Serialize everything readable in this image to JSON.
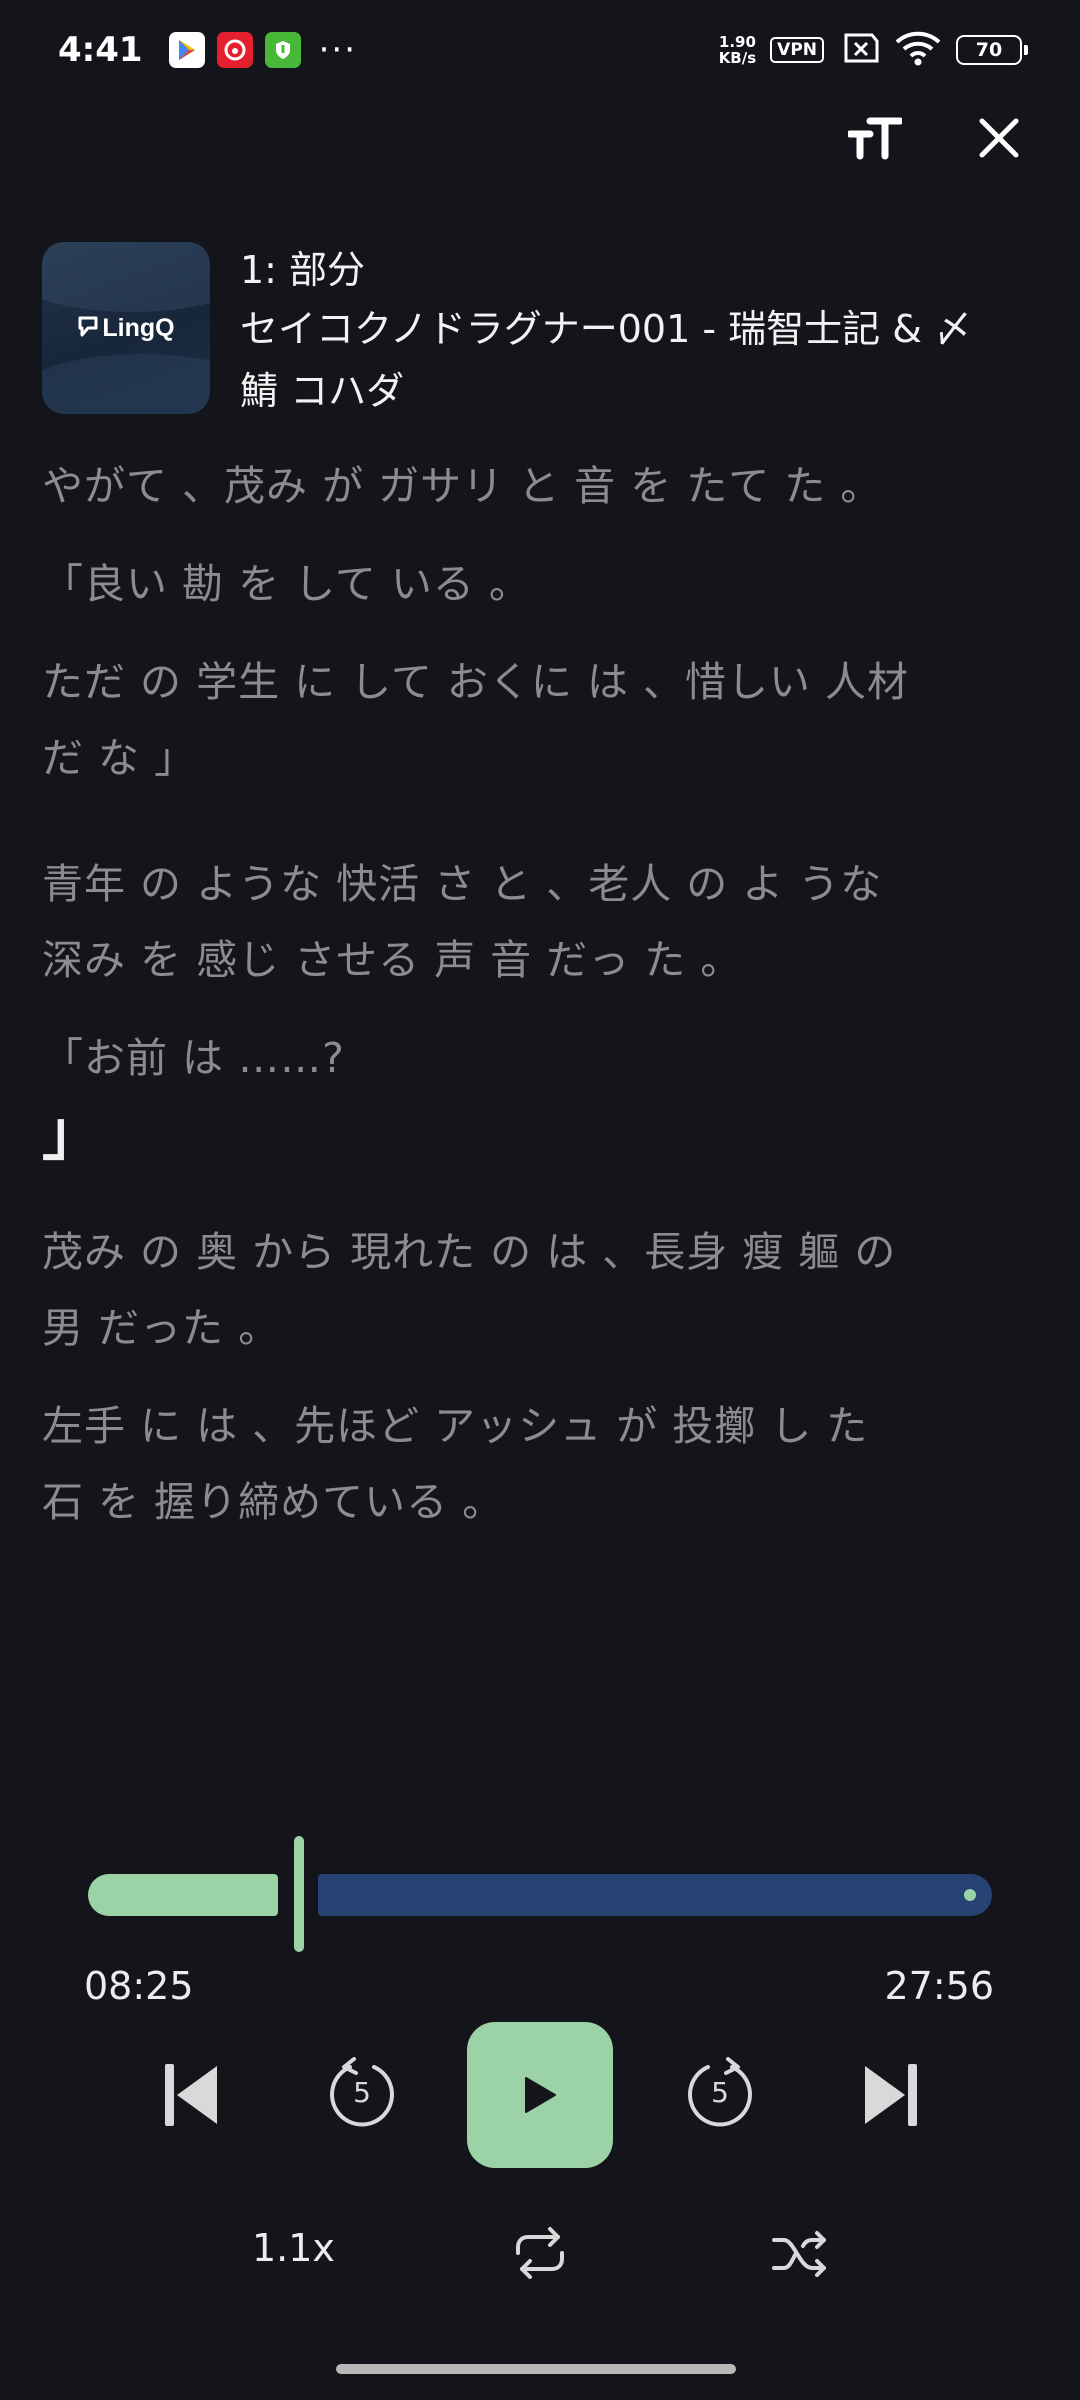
{
  "status_bar": {
    "time": "4:41",
    "more": "···",
    "net_speed_value": "1.90",
    "net_speed_unit": "KB/s",
    "vpn": "VPN",
    "battery": "70"
  },
  "toolbar": {
    "text_size_icon": "text-size-icon",
    "close_icon": "close-icon"
  },
  "lesson": {
    "thumbnail_logo": "LingQ",
    "number": "1: 部分",
    "title": "セイコクノドラグナー001 - 瑞智士記 & 〆鯖 コハダ"
  },
  "transcript": [
    "やがて 、茂み が ガサリ と 音 を たて た 。",
    "「良い 勘 を して いる 。",
    "ただ の 学生 に して おくに は 、惜しい 人材 だ な 」",
    "青年 の ような 快活 さ と 、老人 の よ うな 深み を 感じ させる 声 音 だっ た 。",
    "「お前 は ……?",
    "」",
    "茂み の 奥 から 現れた の は 、長身 瘦 軀 の 男 だった 。",
    "左手 に は 、先ほど アッシュ が 投擲 し た 石 を 握り締めている 。"
  ],
  "player": {
    "elapsed": "08:25",
    "total": "27:56",
    "progress_fraction": 0.3,
    "rewind_seconds": "5",
    "forward_seconds": "5",
    "speed": "1.1x",
    "accent_color": "#9bd3a6",
    "remaining_color": "#264373"
  }
}
